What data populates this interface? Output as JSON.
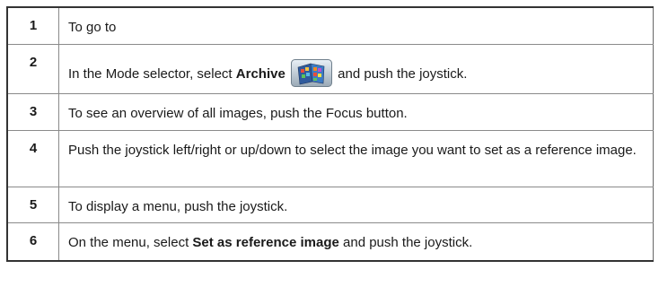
{
  "steps": [
    {
      "number": "1",
      "text": "To go to"
    },
    {
      "number": "2",
      "text_before": "In the Mode selector, select ",
      "bold": "Archive",
      "text_after": " and push the joystick.",
      "icon": "archive-mode-icon"
    },
    {
      "number": "3",
      "text": "To see an overview of all images, push the Focus button."
    },
    {
      "number": "4",
      "text": "Push the joystick left/right or up/down to select the image you want to set as a reference image."
    },
    {
      "number": "5",
      "text": "To display a menu, push the joystick."
    },
    {
      "number": "6",
      "text_before": "On the menu, select ",
      "bold": "Set as reference image",
      "text_after": " and push the joystick."
    }
  ]
}
